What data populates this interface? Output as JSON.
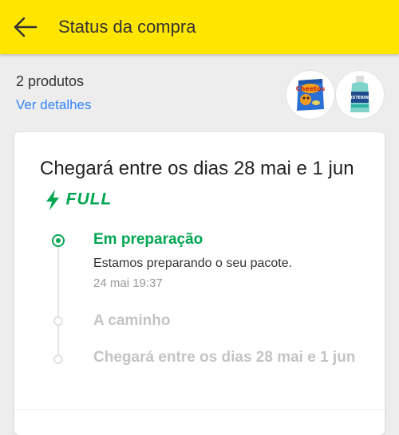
{
  "header": {
    "title": "Status da compra",
    "back_icon": "arrow-left-icon",
    "background": "#ffe600"
  },
  "order": {
    "products_count": "2 produtos",
    "details_link": "Ver detalhes",
    "thumbnails": [
      {
        "icon": "cheetos-bag-icon"
      },
      {
        "icon": "listerine-bottle-icon"
      }
    ]
  },
  "delivery": {
    "text_line": "Chegará entre os dias 28 mai e 1 jun",
    "badge_label": "FULL",
    "badge_icon": "lightning-bolt-icon",
    "accent_color": "#00a650"
  },
  "timeline": {
    "steps": [
      {
        "title": "Em preparação",
        "description": "Estamos preparando o seu pacote.",
        "time": "24 mai 19:37",
        "state": "active"
      },
      {
        "title": "A caminho",
        "state": "pending"
      },
      {
        "title": "Chegará entre os dias 28 mai e 1 jun",
        "state": "pending"
      }
    ]
  }
}
